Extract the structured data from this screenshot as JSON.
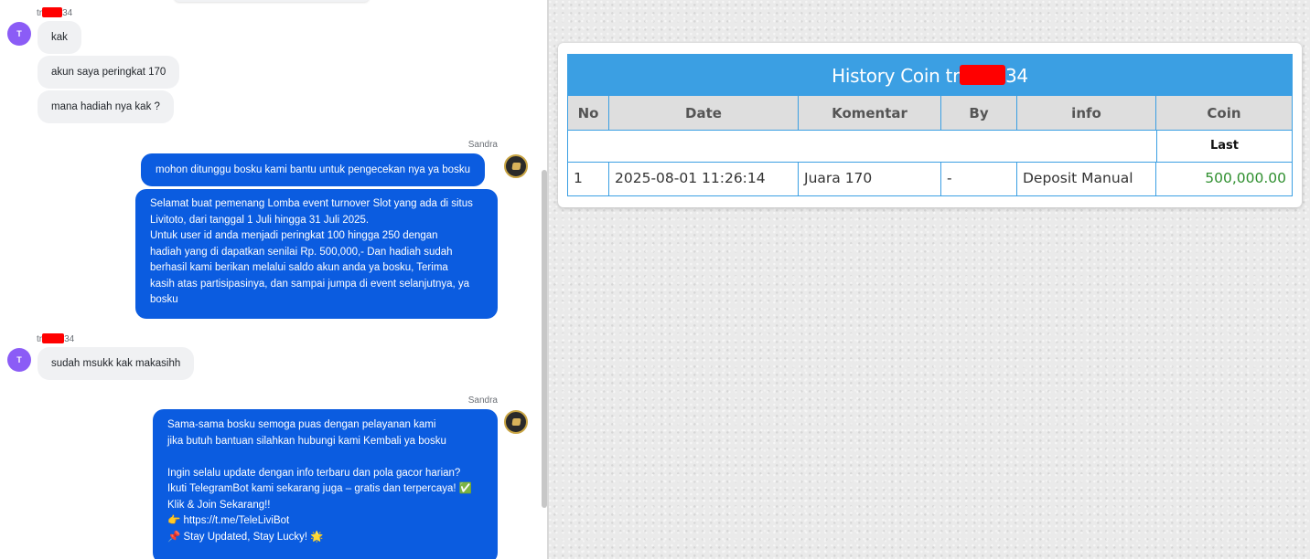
{
  "chat": {
    "messages": [
      {
        "from": "user",
        "avatar": "T",
        "username_prefix": "tr",
        "username_suffix": "34",
        "lines": [
          "kak",
          "akun saya peringkat 170",
          "mana hadiah nya kak ?"
        ]
      },
      {
        "from": "agent",
        "sender": "Sandra",
        "bubbles": [
          [
            "mohon ditunggu bosku kami bantu untuk pengecekan nya ya bosku"
          ],
          [
            "Selamat buat pemenang Lomba event turnover Slot yang ada di situs",
            "Livitoto, dari tanggal 1 Juli hingga 31 Juli 2025.",
            "Untuk user id anda menjadi peringkat 100 hingga 250 dengan",
            "hadiah yang di dapatkan senilai Rp. 500,000,- Dan hadiah sudah",
            "berhasil kami berikan melalui saldo akun anda ya bosku, Terima",
            "kasih atas partisipasinya, dan sampai jumpa di event selanjutnya, ya",
            "bosku"
          ]
        ]
      },
      {
        "from": "user",
        "avatar": "T",
        "username_prefix": "tr",
        "username_suffix": "34",
        "lines": [
          "sudah msukk kak makasihh"
        ]
      },
      {
        "from": "agent",
        "sender": "Sandra",
        "bubbles": [
          [
            "Sama-sama bosku semoga puas dengan pelayanan kami",
            "jika butuh bantuan silahkan hubungi kami Kembali ya bosku",
            "",
            "Ingin selalu update dengan info terbaru dan pola gacor harian?",
            "Ikuti TelegramBot kami sekarang juga – gratis dan terpercaya! ✅",
            "Klik & Join Sekarang!!",
            "👉 https://t.me/TeleLiviBot",
            "📌 Stay Updated, Stay Lucky! 🌟"
          ]
        ]
      }
    ]
  },
  "history": {
    "title_prefix": "History Coin tr",
    "title_suffix": "34",
    "columns": [
      "No",
      "Date",
      "Komentar",
      "By",
      "info",
      "Coin"
    ],
    "last_label": "Last",
    "rows": [
      {
        "no": "1",
        "date": "2025-08-01 11:26:14",
        "komentar": "Juara 170",
        "by": "-",
        "info": "Deposit Manual",
        "coin": "500,000.00"
      }
    ]
  },
  "colors": {
    "agent_bubble": "#0b5ce0",
    "user_bubble": "#f0f1f3",
    "avatar": "#8b5cf6",
    "table_header_bar": "#3b9fe3",
    "coin_value": "#2f8f2f",
    "redaction": "#ff0000"
  }
}
